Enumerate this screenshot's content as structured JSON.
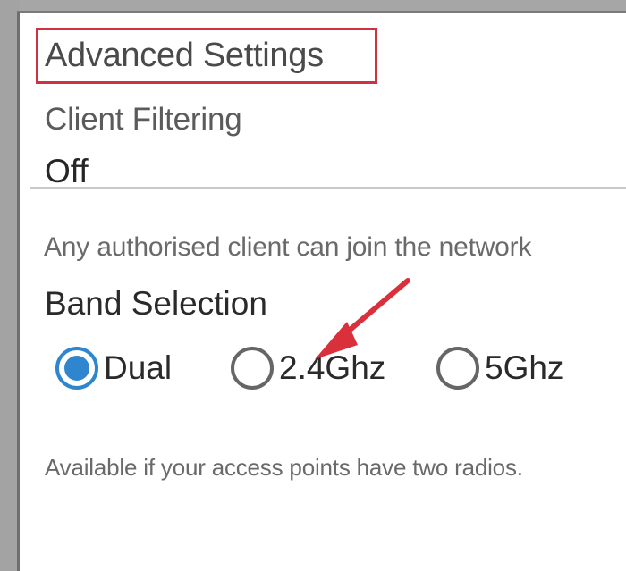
{
  "advanced_settings": {
    "title": "Advanced Settings",
    "client_filtering": {
      "label": "Client Filtering",
      "value": "Off",
      "help": "Any authorised client can join the network"
    },
    "band_selection": {
      "label": "Band Selection",
      "options": [
        {
          "label": "Dual",
          "selected": true
        },
        {
          "label": "2.4Ghz",
          "selected": false
        },
        {
          "label": "5Ghz",
          "selected": false
        }
      ],
      "selected": "Dual",
      "help": "Available if your access points have two radios."
    }
  },
  "colors": {
    "accent": "#2f86cf",
    "highlight_box": "#d0303f",
    "annotation_arrow": "#d9303b"
  }
}
